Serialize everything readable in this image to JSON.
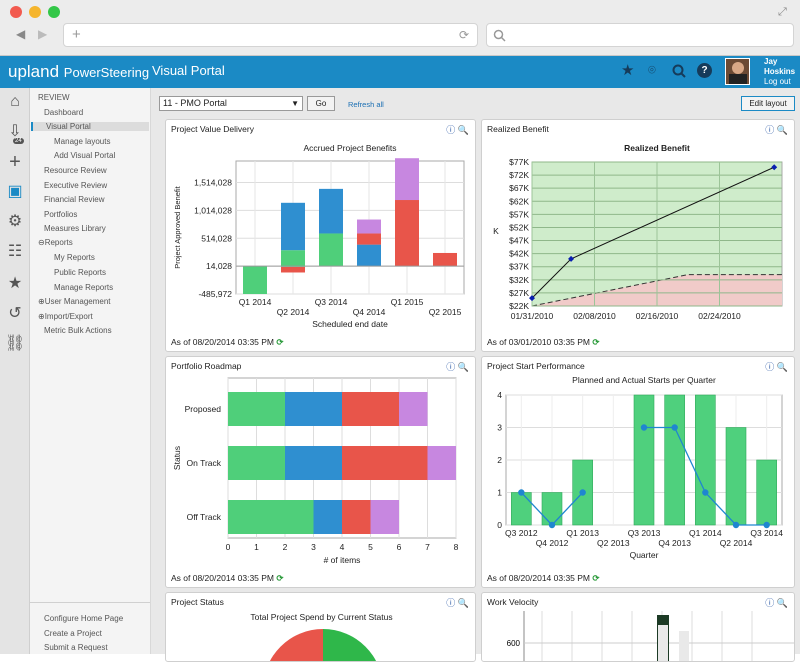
{
  "app": {
    "brand_upland": "upland",
    "brand_product": "PowerSteering",
    "page_title": "Visual Portal",
    "user_first": "Jay",
    "user_last": "Hoskins",
    "logout": "Log out"
  },
  "sidebar": {
    "section": "REVIEW",
    "items": [
      {
        "label": "Dashboard",
        "sub": false
      },
      {
        "label": "Visual Portal",
        "sub": false,
        "active": true
      },
      {
        "label": "Manage layouts",
        "sub": true
      },
      {
        "label": "Add Visual Portal",
        "sub": true
      },
      {
        "label": "Resource Review",
        "sub": false
      },
      {
        "label": "Executive Review",
        "sub": false
      },
      {
        "label": "Financial Review",
        "sub": false
      },
      {
        "label": "Portfolios",
        "sub": false
      },
      {
        "label": "Measures Library",
        "sub": false
      },
      {
        "label": "Reports",
        "sub": false,
        "collapse": "⊖"
      },
      {
        "label": "My Reports",
        "sub": true
      },
      {
        "label": "Public Reports",
        "sub": true
      },
      {
        "label": "Manage Reports",
        "sub": true
      },
      {
        "label": "User Management",
        "sub": false,
        "collapse": "⊕"
      },
      {
        "label": "Import/Export",
        "sub": false,
        "collapse": "⊕"
      },
      {
        "label": "Metric Bulk Actions",
        "sub": false
      }
    ],
    "bottom": [
      "Configure Home Page",
      "Create a Project",
      "Submit a Request"
    ]
  },
  "leftnav": {
    "badge": "24"
  },
  "toolbar": {
    "portal_select": "11 - PMO Portal",
    "go": "Go",
    "refresh_all": "Refresh all",
    "edit_layout": "Edit layout"
  },
  "panels": {
    "pvd": {
      "title": "Project Value Delivery",
      "footer": "As of 08/20/2014 03:35 PM"
    },
    "rb": {
      "title": "Realized Benefit",
      "footer": "As of 03/01/2010 03:35 PM"
    },
    "pr": {
      "title": "Portfolio Roadmap",
      "footer": "As of 08/20/2014 03:35 PM"
    },
    "psp": {
      "title": "Project Start Performance",
      "footer": "As of 08/20/2014 03:35 PM"
    },
    "ps": {
      "title": "Project Status",
      "chart_title": "Total Project Spend by Current Status"
    },
    "wv": {
      "title": "Work Velocity",
      "ytick": "600"
    }
  },
  "colors": {
    "green": "#4fcf7a",
    "blue": "#2f8fd0",
    "red": "#e8554a",
    "purple": "#c787e0",
    "accent": "#1b8ac5"
  },
  "chart_data": [
    {
      "id": "pvd",
      "type": "bar",
      "title": "Accrued Project Benefits",
      "xlabel": "Scheduled end date",
      "ylabel": "Project Approved Benefit",
      "categories": [
        "Q1 2014",
        "Q2 2014",
        "Q3 2014",
        "Q4 2014",
        "Q1 2015",
        "Q2 2015"
      ],
      "yticks": [
        "1,514,028",
        "1,014,028",
        "514,028",
        "14,028",
        "-485,972"
      ],
      "ylim": [
        -485972,
        1900000
      ],
      "segments": [
        [
          {
            "c": "green",
            "from": -485972,
            "to": 14028
          }
        ],
        [
          {
            "c": "red",
            "from": -100000,
            "to": 0
          },
          {
            "c": "green",
            "from": 0,
            "to": 300000
          },
          {
            "c": "blue",
            "from": 300000,
            "to": 1150000
          }
        ],
        [
          {
            "c": "green",
            "from": 14028,
            "to": 600000
          },
          {
            "c": "blue",
            "from": 600000,
            "to": 1400000
          }
        ],
        [
          {
            "c": "blue",
            "from": 14028,
            "to": 400000
          },
          {
            "c": "red",
            "from": 400000,
            "to": 600000
          },
          {
            "c": "purple",
            "from": 600000,
            "to": 850000
          }
        ],
        [
          {
            "c": "red",
            "from": 14028,
            "to": 1200000
          },
          {
            "c": "purple",
            "from": 1200000,
            "to": 1950000
          }
        ],
        [
          {
            "c": "red",
            "from": 14028,
            "to": 250000
          }
        ]
      ]
    },
    {
      "id": "rb",
      "type": "line",
      "title": "Realized Benefit",
      "ylabel": "K",
      "yticks": [
        "$77K",
        "$72K",
        "$67K",
        "$62K",
        "$57K",
        "$52K",
        "$47K",
        "$42K",
        "$37K",
        "$32K",
        "$27K",
        "$22K"
      ],
      "xticks": [
        "01/31/2010",
        "02/08/2010",
        "02/16/2010",
        "02/24/2010"
      ],
      "ylim": [
        22,
        77
      ],
      "xlim": [
        0,
        32
      ],
      "series": [
        {
          "x": [
            0,
            5,
            31
          ],
          "y": [
            25,
            40,
            75
          ]
        }
      ],
      "threshold": {
        "x": [
          0,
          20,
          31
        ],
        "y": [
          22,
          34,
          34
        ]
      }
    },
    {
      "id": "pr",
      "type": "bar",
      "orientation": "horizontal",
      "xlabel": "# of items",
      "ylabel": "Status",
      "categories": [
        "Proposed",
        "On Track",
        "Off Track"
      ],
      "xticks": [
        "0",
        "1",
        "2",
        "3",
        "4",
        "5",
        "6",
        "7",
        "8"
      ],
      "xlim": [
        0,
        8
      ],
      "segments": [
        [
          {
            "c": "green",
            "v": 2
          },
          {
            "c": "blue",
            "v": 2
          },
          {
            "c": "red",
            "v": 2
          },
          {
            "c": "purple",
            "v": 1
          }
        ],
        [
          {
            "c": "green",
            "v": 2
          },
          {
            "c": "blue",
            "v": 2
          },
          {
            "c": "red",
            "v": 3
          },
          {
            "c": "purple",
            "v": 1
          }
        ],
        [
          {
            "c": "green",
            "v": 3
          },
          {
            "c": "blue",
            "v": 1
          },
          {
            "c": "red",
            "v": 1
          },
          {
            "c": "purple",
            "v": 1
          }
        ]
      ]
    },
    {
      "id": "psp",
      "type": "bar",
      "title": "Planned and Actual Starts per Quarter",
      "xlabel": "Quarter",
      "categories": [
        "Q3 2012",
        "Q4 2012",
        "Q1 2013",
        "Q2 2013",
        "Q3 2013",
        "Q4 2013",
        "Q1 2014",
        "Q2 2014",
        "Q3 2014"
      ],
      "values": [
        1,
        1,
        2,
        0,
        4,
        4,
        4,
        3,
        2
      ],
      "line": [
        1,
        0,
        1,
        null,
        3,
        3,
        1,
        0,
        0
      ],
      "yticks": [
        "0",
        "1",
        "2",
        "3",
        "4"
      ],
      "ylim": [
        0,
        4
      ]
    }
  ]
}
